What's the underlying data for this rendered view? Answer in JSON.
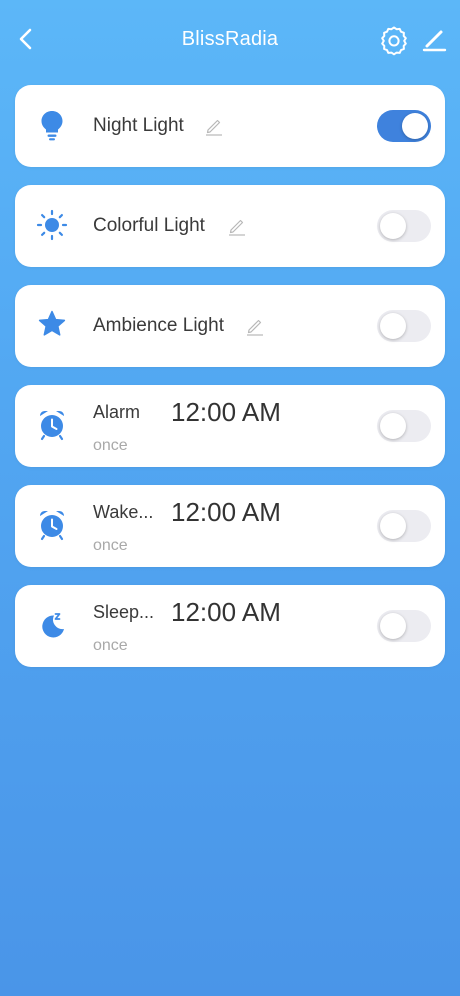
{
  "header": {
    "title": "BlissRadia",
    "back_icon": "chevron-left-icon",
    "settings_icon": "gear-icon",
    "edit_icon": "pencil-icon"
  },
  "colors": {
    "background_top": "#5cb7f8",
    "background_bottom": "#4a95e8",
    "accent": "#3f82dd",
    "icon_blue": "#3d8ae6",
    "toggle_off": "#ececf1"
  },
  "lights": [
    {
      "label": "Night Light",
      "icon": "lightbulb-icon",
      "enabled": true
    },
    {
      "label": "Colorful Light",
      "icon": "sun-icon",
      "enabled": false
    },
    {
      "label": "Ambience Light",
      "icon": "star-icon",
      "enabled": false
    }
  ],
  "timers": [
    {
      "name": "Alarm",
      "time": "12:00 AM",
      "repeat": "once",
      "icon": "alarm-clock-icon",
      "enabled": false
    },
    {
      "name": "Wake...",
      "time": "12:00 AM",
      "repeat": "once",
      "icon": "alarm-clock-icon",
      "enabled": false
    },
    {
      "name": "Sleep...",
      "time": "12:00 AM",
      "repeat": "once",
      "icon": "moon-sleep-icon",
      "enabled": false
    }
  ]
}
